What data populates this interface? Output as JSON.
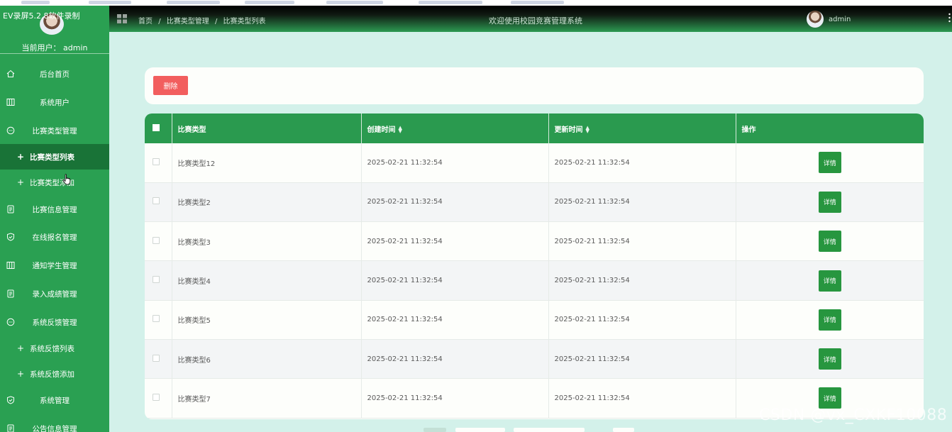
{
  "recorder_label": "EV录屏5.2.8软件录制",
  "sidebar": {
    "current_user": "当前用户： admin",
    "items": [
      {
        "label": "后台首页",
        "icon": "home-icon"
      },
      {
        "label": "系统用户",
        "icon": "columns-icon"
      },
      {
        "label": "比赛类型管理",
        "icon": "chat-bubble-icon"
      },
      {
        "label": "比赛类型列表",
        "sub": true,
        "active": true
      },
      {
        "label": "比赛类型添加",
        "sub": true
      },
      {
        "label": "比赛信息管理",
        "icon": "document-icon"
      },
      {
        "label": "在线报名管理",
        "icon": "shield-check-icon"
      },
      {
        "label": "通知学生管理",
        "icon": "columns-icon"
      },
      {
        "label": "录入成绩管理",
        "icon": "document-icon"
      },
      {
        "label": "系统反馈管理",
        "icon": "chat-bubble-icon"
      },
      {
        "label": "系统反馈列表",
        "sub": true
      },
      {
        "label": "系统反馈添加",
        "sub": true
      },
      {
        "label": "系统管理",
        "icon": "shield-check-icon"
      },
      {
        "label": "公告信息管理",
        "icon": "document-icon"
      }
    ]
  },
  "header": {
    "breadcrumb": [
      "首页",
      "比赛类型管理",
      "比赛类型列表"
    ],
    "breadcrumb_sep": "/",
    "title": "欢迎使用校园竞赛管理系统",
    "user": "admin"
  },
  "toolbar": {
    "delete_label": "删除"
  },
  "table": {
    "columns": [
      "比赛类型",
      "创建时间",
      "更新时间",
      "操作"
    ],
    "sort_icon": "sort-icon",
    "detail_label": "详情",
    "rows": [
      {
        "type": "比赛类型12",
        "created": "2025-02-21 11:32:54",
        "updated": "2025-02-21 11:32:54"
      },
      {
        "type": "比赛类型2",
        "created": "2025-02-21 11:32:54",
        "updated": "2025-02-21 11:32:54"
      },
      {
        "type": "比赛类型3",
        "created": "2025-02-21 11:32:54",
        "updated": "2025-02-21 11:32:54"
      },
      {
        "type": "比赛类型4",
        "created": "2025-02-21 11:32:54",
        "updated": "2025-02-21 11:32:54"
      },
      {
        "type": "比赛类型5",
        "created": "2025-02-21 11:32:54",
        "updated": "2025-02-21 11:32:54"
      },
      {
        "type": "比赛类型6",
        "created": "2025-02-21 11:32:54",
        "updated": "2025-02-21 11:32:54"
      },
      {
        "type": "比赛类型7",
        "created": "2025-02-21 11:32:54",
        "updated": "2025-02-21 11:32:54"
      }
    ]
  },
  "watermark": "CSDN @vx_CXKF10088",
  "colors": {
    "sidebar_bg": "#2aa052",
    "sidebar_active": "#197337",
    "content_bg": "#d3f1ea",
    "table_header": "#2a9a4f",
    "delete_button": "#f25e5e",
    "detail_button": "#27963f"
  }
}
